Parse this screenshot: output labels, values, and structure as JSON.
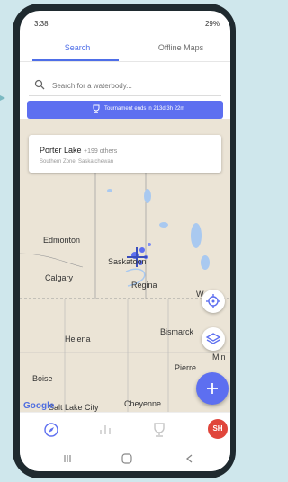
{
  "status_bar": {
    "time": "3:38",
    "battery": "29%"
  },
  "tabs": [
    {
      "label": "Search",
      "active": true
    },
    {
      "label": "Offline Maps",
      "active": false
    }
  ],
  "search": {
    "placeholder": "Search for a waterbody..."
  },
  "banner": {
    "text": "Tournament ends in 213d 3h 22m"
  },
  "lake_card": {
    "title": "Porter Lake",
    "others": "+199 others",
    "subtitle": "Southern Zone, Saskatchewan"
  },
  "map": {
    "cities": {
      "edmonton": "Edmonton",
      "saskatoon": "Saskatoon",
      "calgary": "Calgary",
      "regina": "Regina",
      "winnipeg_partial": "W",
      "helena": "Helena",
      "bismarck": "Bismarck",
      "pierre": "Pierre",
      "minneapolis_partial": "Min",
      "boise": "Boise",
      "salt_lake_city": "Salt Lake City",
      "cheyenne": "Cheyenne"
    },
    "google_text": "Google"
  },
  "bottom_nav": {
    "avatar_initials": "SH"
  },
  "colors": {
    "accent": "#4e6ee8",
    "banner": "#5d6ff0",
    "avatar": "#e0453b",
    "map": "#ebe4d6"
  },
  "icons": [
    "search-icon",
    "trophy-icon",
    "locate-icon",
    "layers-icon",
    "plus-icon",
    "compass-icon",
    "chart-icon",
    "trophy-icon",
    "back-icon",
    "home-icon",
    "recents-icon"
  ]
}
